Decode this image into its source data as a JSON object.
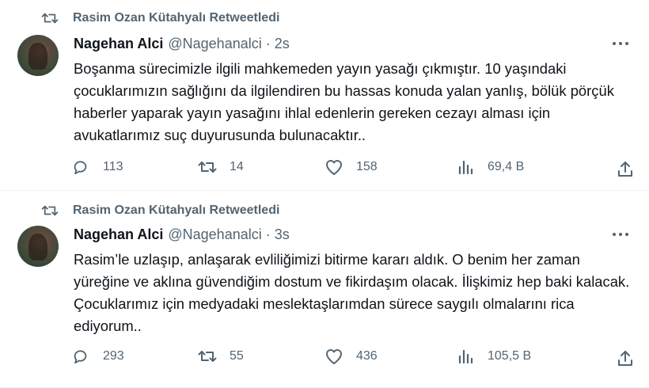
{
  "tweets": [
    {
      "retweeted_by": "Rasim Ozan Kütahyalı Retweetledi",
      "name": "Nagehan Alci",
      "handle": "@Nagehanalci · 2s",
      "text": "Boşanma sürecimizle ilgili mahkemeden yayın yasağı çıkmıştır. 10 yaşındaki çocuklarımızın sağlığını da ilgilendiren bu hassas konuda yalan yanlış, bölük pörçük haberler yaparak yayın yasağını ihlal edenlerin gereken cezayı alması için avukatlarımız suç duyurusunda bulunacaktır..",
      "replies": "113",
      "retweets": "14",
      "likes": "158",
      "views": "69,4 B"
    },
    {
      "retweeted_by": "Rasim Ozan Kütahyalı Retweetledi",
      "name": "Nagehan Alci",
      "handle": "@Nagehanalci · 3s",
      "text": "Rasim’le uzlaşıp, anlaşarak evliliğimizi bitirme kararı aldık. O benim her zaman yüreğine ve aklına güvendiğim dostum ve fikirdaşım olacak. İlişkimiz hep baki kalacak. Çocuklarımız için medyadaki meslektaşlarımdan sürece saygılı olmalarını rica ediyorum..",
      "replies": "293",
      "retweets": "55",
      "likes": "436",
      "views": "105,5 B"
    }
  ],
  "icons": {
    "retweet": "retweet-icon",
    "reply": "reply-icon",
    "like": "heart-icon",
    "views": "views-icon",
    "share": "share-icon",
    "more": "more-icon"
  },
  "colors": {
    "muted": "#536471",
    "text": "#0f1419",
    "divider": "#eff3f4"
  }
}
